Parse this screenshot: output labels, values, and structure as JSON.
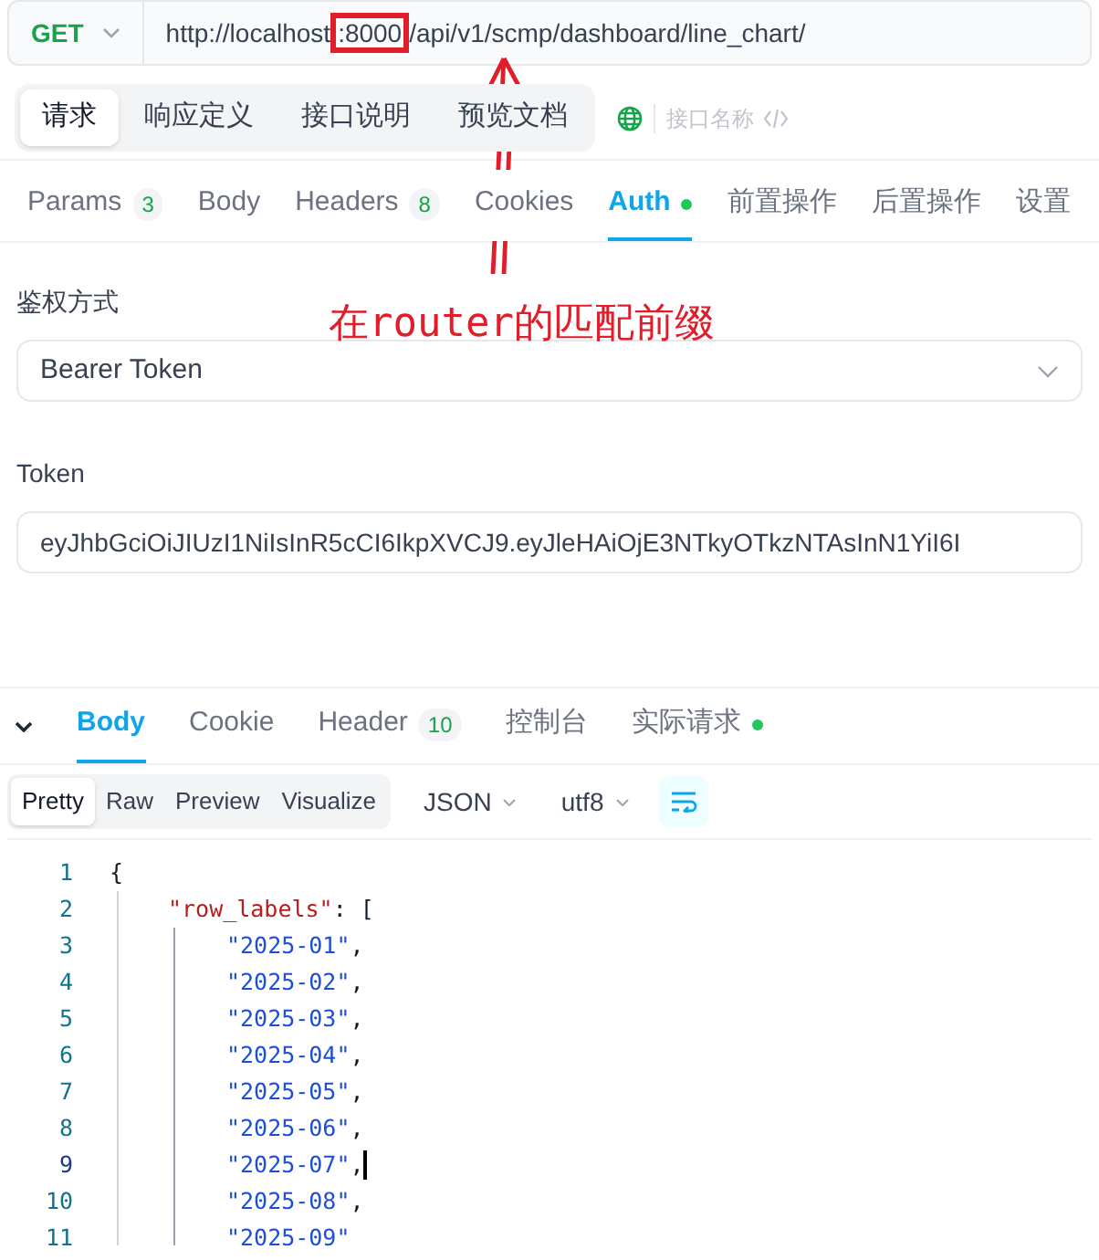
{
  "request": {
    "method": "GET",
    "url_parts": [
      {
        "text": "http://localhost",
        "highlighted": false
      },
      {
        "text": ":8000",
        "highlighted": true
      },
      {
        "text": "/api/v1/scmp/dashboard/line_chart/",
        "highlighted": false
      }
    ]
  },
  "doc_tabs": [
    {
      "label": "请求",
      "selected": true
    },
    {
      "label": "响应定义",
      "selected": false
    },
    {
      "label": "接口说明",
      "selected": false
    },
    {
      "label": "预览文档",
      "selected": false
    }
  ],
  "name_field": {
    "placeholder": "接口名称"
  },
  "request_tabs": [
    {
      "label": "Params",
      "count": "3",
      "selected": false,
      "dot": false
    },
    {
      "label": "Body",
      "selected": false,
      "dot": false
    },
    {
      "label": "Headers",
      "count": "8",
      "selected": false,
      "dot": false
    },
    {
      "label": "Cookies",
      "selected": false,
      "dot": false
    },
    {
      "label": "Auth",
      "selected": true,
      "dot": true
    },
    {
      "label": "前置操作",
      "selected": false,
      "dot": false
    },
    {
      "label": "后置操作",
      "selected": false,
      "dot": false
    },
    {
      "label": "设置",
      "selected": false,
      "dot": false
    }
  ],
  "auth": {
    "type_label": "鉴权方式",
    "type_value": "Bearer Token",
    "token_label": "Token",
    "token_value": "eyJhbGciOiJIUzI1NiIsInR5cCI6IkpXVCJ9.eyJleHAiOjE3NTkyOTkzNTAsInN1YiI6I"
  },
  "annotation": {
    "text": "在router的匹配前缀"
  },
  "response_tabs": [
    {
      "label": "Body",
      "selected": true,
      "dot": false
    },
    {
      "label": "Cookie",
      "selected": false,
      "dot": false
    },
    {
      "label": "Header",
      "count": "10",
      "selected": false,
      "dot": false
    },
    {
      "label": "控制台",
      "selected": false,
      "dot": false
    },
    {
      "label": "实际请求",
      "selected": false,
      "dot": true
    }
  ],
  "view_modes": [
    {
      "label": "Pretty",
      "selected": true
    },
    {
      "label": "Raw",
      "selected": false
    },
    {
      "label": "Preview",
      "selected": false
    },
    {
      "label": "Visualize",
      "selected": false
    }
  ],
  "format": "JSON",
  "encoding": "utf8",
  "wrap": {
    "on": true
  },
  "code_lines": [
    {
      "number": "1",
      "kind": "open",
      "current": false,
      "parts": [
        {
          "kind": "punct",
          "text": "{"
        }
      ]
    },
    {
      "number": "2",
      "kind": "key",
      "current": false,
      "parts": [
        {
          "kind": "key",
          "text": "\"row_labels\""
        },
        {
          "kind": "punct",
          "text": ": ["
        }
      ]
    },
    {
      "number": "3",
      "kind": "item",
      "current": false,
      "parts": [
        {
          "kind": "string",
          "text": "\"2025-01\""
        },
        {
          "kind": "punct",
          "text": ","
        }
      ]
    },
    {
      "number": "4",
      "kind": "item",
      "current": false,
      "parts": [
        {
          "kind": "string",
          "text": "\"2025-02\""
        },
        {
          "kind": "punct",
          "text": ","
        }
      ]
    },
    {
      "number": "5",
      "kind": "item",
      "current": false,
      "parts": [
        {
          "kind": "string",
          "text": "\"2025-03\""
        },
        {
          "kind": "punct",
          "text": ","
        }
      ]
    },
    {
      "number": "6",
      "kind": "item",
      "current": false,
      "parts": [
        {
          "kind": "string",
          "text": "\"2025-04\""
        },
        {
          "kind": "punct",
          "text": ","
        }
      ]
    },
    {
      "number": "7",
      "kind": "item",
      "current": false,
      "parts": [
        {
          "kind": "string",
          "text": "\"2025-05\""
        },
        {
          "kind": "punct",
          "text": ","
        }
      ]
    },
    {
      "number": "8",
      "kind": "item",
      "current": false,
      "parts": [
        {
          "kind": "string",
          "text": "\"2025-06\""
        },
        {
          "kind": "punct",
          "text": ","
        }
      ]
    },
    {
      "number": "9",
      "kind": "item",
      "current": true,
      "parts": [
        {
          "kind": "string",
          "text": "\"2025-07\""
        },
        {
          "kind": "punct",
          "text": ","
        }
      ]
    },
    {
      "number": "10",
      "kind": "item",
      "current": false,
      "parts": [
        {
          "kind": "string",
          "text": "\"2025-08\""
        },
        {
          "kind": "punct",
          "text": ","
        }
      ]
    },
    {
      "number": "11",
      "kind": "item",
      "current": false,
      "parts": [
        {
          "kind": "string",
          "text": "\"2025-09\""
        }
      ]
    }
  ]
}
